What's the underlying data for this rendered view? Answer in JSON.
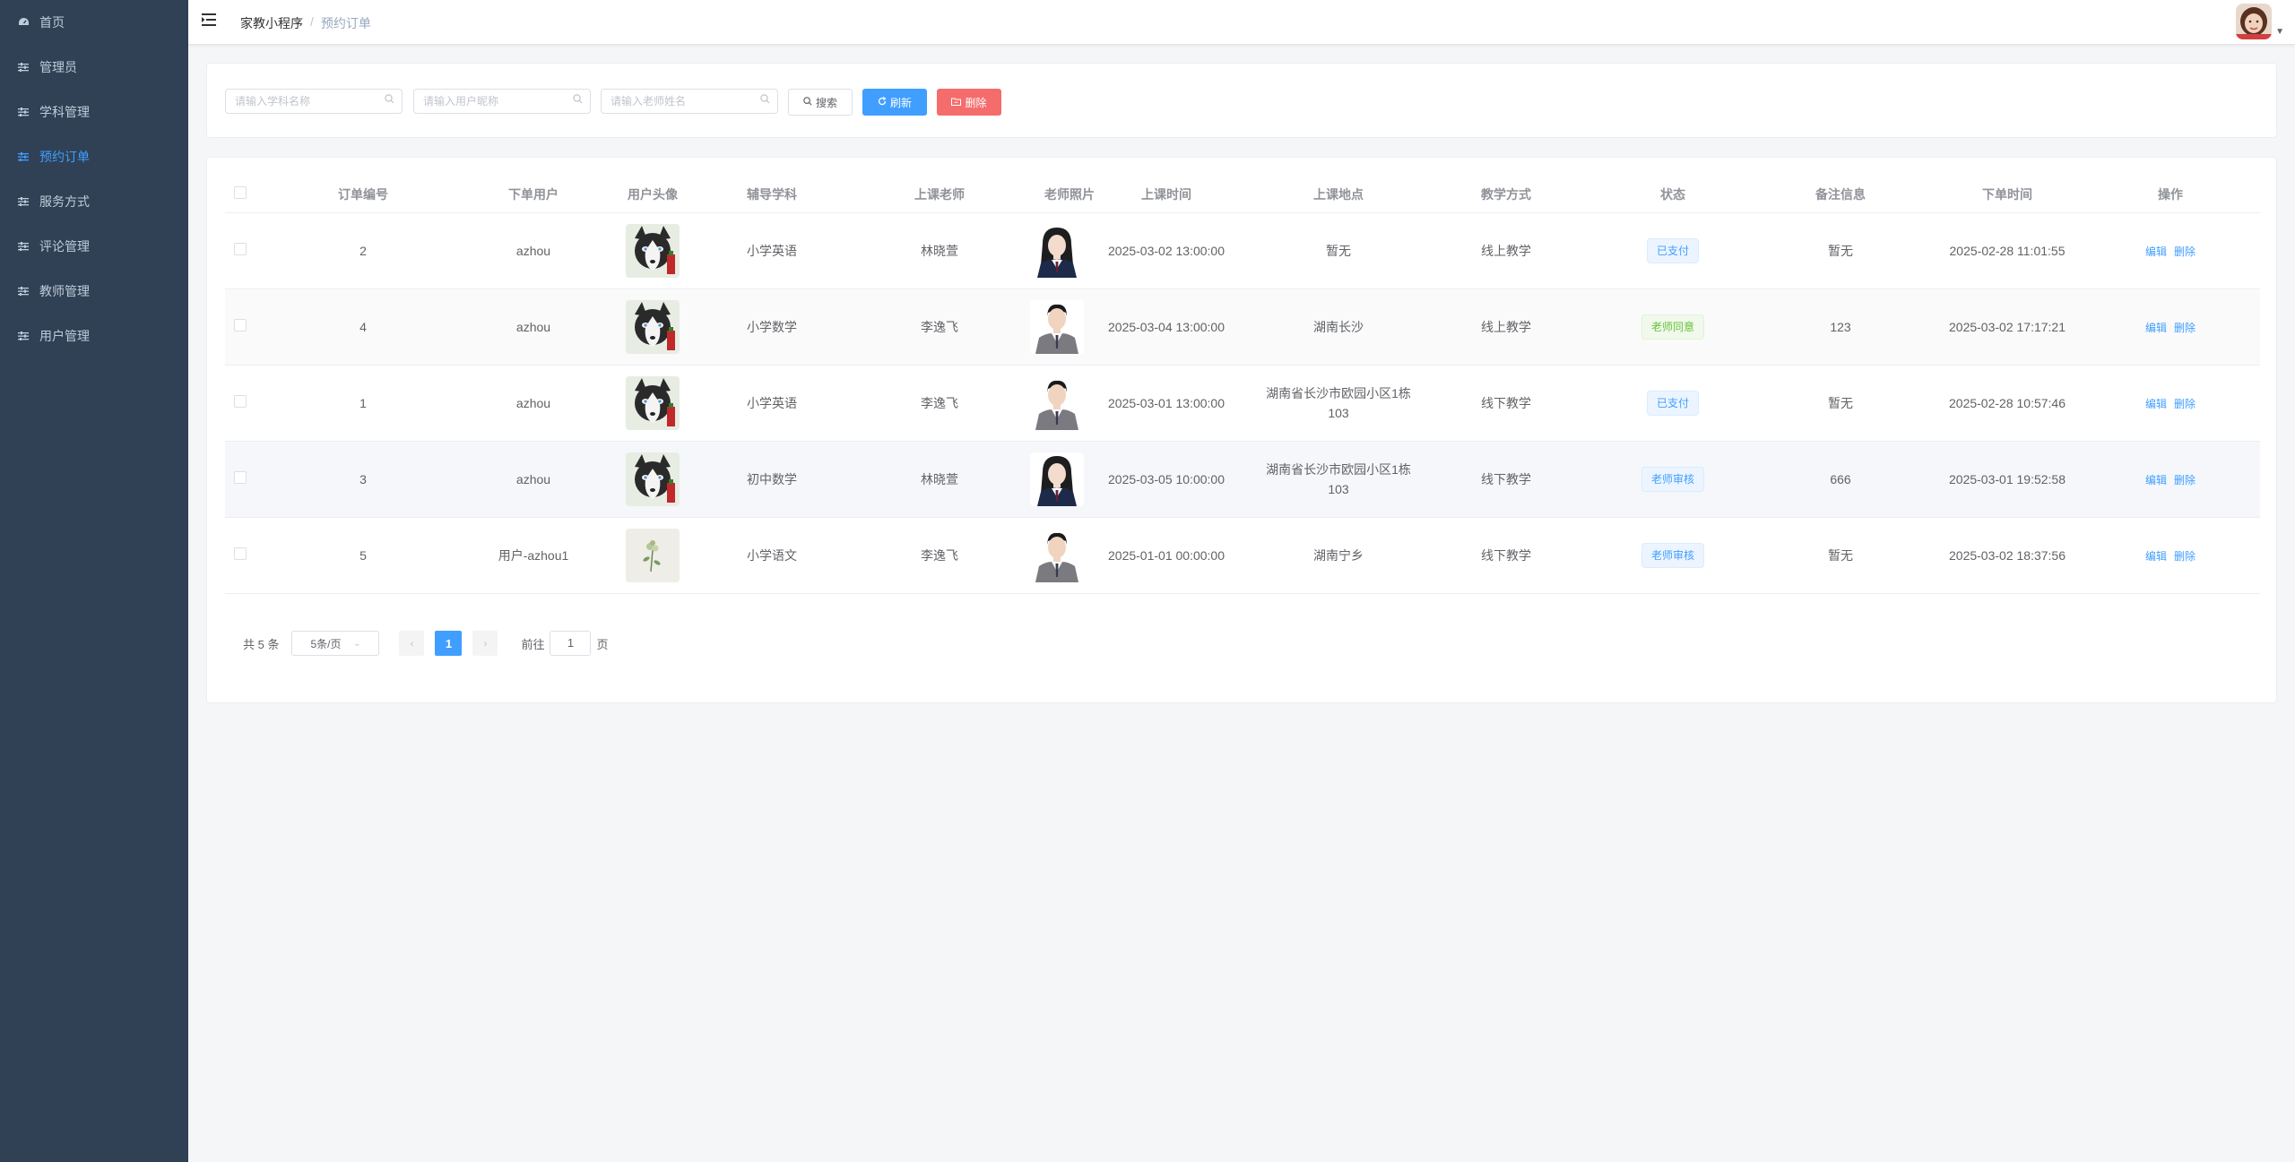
{
  "sidebar": {
    "items": [
      {
        "label": "首页",
        "icon": "dashboard-icon"
      },
      {
        "label": "管理员",
        "icon": "sliders-icon"
      },
      {
        "label": "学科管理",
        "icon": "sliders-icon"
      },
      {
        "label": "预约订单",
        "icon": "sliders-icon"
      },
      {
        "label": "服务方式",
        "icon": "sliders-icon"
      },
      {
        "label": "评论管理",
        "icon": "sliders-icon"
      },
      {
        "label": "教师管理",
        "icon": "sliders-icon"
      },
      {
        "label": "用户管理",
        "icon": "sliders-icon"
      }
    ],
    "active_index": 3,
    "bg_color": "#304156",
    "active_color": "#409eff"
  },
  "header": {
    "breadcrumb_home": "家教小程序",
    "breadcrumb_sep": "/",
    "breadcrumb_current": "预约订单"
  },
  "search": {
    "subject_placeholder": "请输入学科名称",
    "user_placeholder": "请输入用户昵称",
    "teacher_placeholder": "请输入老师姓名",
    "search_label": "搜索",
    "refresh_label": "刷新",
    "delete_label": "删除"
  },
  "table": {
    "headers": {
      "order_no": "订单编号",
      "user": "下单用户",
      "avatar": "用户头像",
      "subject": "辅导学科",
      "teacher": "上课老师",
      "photo": "老师照片",
      "class_time": "上课时间",
      "place": "上课地点",
      "mode": "教学方式",
      "status": "状态",
      "note": "备注信息",
      "order_time": "下单时间",
      "ops": "操作"
    },
    "rows": [
      {
        "order_no": "2",
        "user": "azhou",
        "avatar": "husky",
        "subject": "小学英语",
        "teacher": "林晓萱",
        "photo": "female",
        "class_time": "2025-03-02 13:00:00",
        "place_line1": "暂无",
        "place_line2": "",
        "mode": "线上教学",
        "status": "已支付",
        "status_type": "blue",
        "note": "暂无",
        "order_time": "2025-02-28 11:01:55",
        "edit": "编辑",
        "delete": "删除"
      },
      {
        "order_no": "4",
        "user": "azhou",
        "avatar": "husky",
        "subject": "小学数学",
        "teacher": "李逸飞",
        "photo": "male",
        "class_time": "2025-03-04 13:00:00",
        "place_line1": "湖南长沙",
        "place_line2": "",
        "mode": "线上教学",
        "status": "老师同意",
        "status_type": "green",
        "note": "123",
        "order_time": "2025-03-02 17:17:21",
        "edit": "编辑",
        "delete": "删除"
      },
      {
        "order_no": "1",
        "user": "azhou",
        "avatar": "husky",
        "subject": "小学英语",
        "teacher": "李逸飞",
        "photo": "male",
        "class_time": "2025-03-01 13:00:00",
        "place_line1": "湖南省长沙市欧园小区1栋",
        "place_line2": "103",
        "mode": "线下教学",
        "status": "已支付",
        "status_type": "blue",
        "note": "暂无",
        "order_time": "2025-02-28 10:57:46",
        "edit": "编辑",
        "delete": "删除"
      },
      {
        "order_no": "3",
        "user": "azhou",
        "avatar": "husky",
        "subject": "初中数学",
        "teacher": "林晓萱",
        "photo": "female",
        "class_time": "2025-03-05 10:00:00",
        "place_line1": "湖南省长沙市欧园小区1栋",
        "place_line2": "103",
        "mode": "线下教学",
        "status": "老师审核",
        "status_type": "blue",
        "note": "666",
        "order_time": "2025-03-01 19:52:58",
        "edit": "编辑",
        "delete": "删除"
      },
      {
        "order_no": "5",
        "user": "用户-azhou1",
        "avatar": "flower",
        "subject": "小学语文",
        "teacher": "李逸飞",
        "photo": "male",
        "class_time": "2025-01-01 00:00:00",
        "place_line1": "湖南宁乡",
        "place_line2": "",
        "mode": "线下教学",
        "status": "老师审核",
        "status_type": "blue",
        "note": "暂无",
        "order_time": "2025-03-02 18:37:56",
        "edit": "编辑",
        "delete": "删除"
      }
    ]
  },
  "pagination": {
    "total": "共 5 条",
    "page_size": "5条/页",
    "current_page": "1",
    "goto_prefix": "前往",
    "goto_value": "1",
    "goto_suffix": "页"
  }
}
